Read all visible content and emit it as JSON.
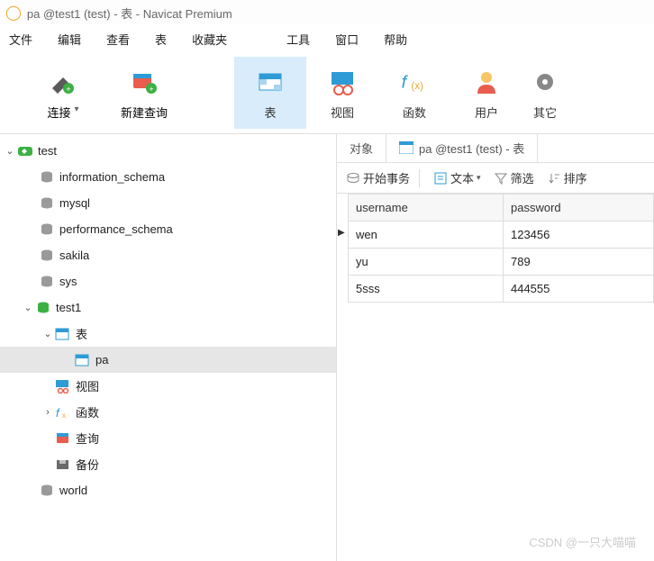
{
  "window": {
    "title": "pa @test1 (test) - 表 - Navicat Premium"
  },
  "menu": {
    "file": "文件",
    "edit": "编辑",
    "view": "查看",
    "table": "表",
    "favorites": "收藏夹",
    "tools": "工具",
    "window": "窗口",
    "help": "帮助"
  },
  "toolbar": {
    "connection": "连接",
    "new_query": "新建查询",
    "table": "表",
    "view": "视图",
    "function": "函数",
    "user": "用户",
    "other": "其它"
  },
  "tree": {
    "conn": "test",
    "dbs": {
      "information_schema": "information_schema",
      "mysql": "mysql",
      "performance_schema": "performance_schema",
      "sakila": "sakila",
      "sys": "sys",
      "test1": "test1",
      "world": "world"
    },
    "groups": {
      "tables": "表",
      "views": "视图",
      "functions": "函数",
      "queries": "查询",
      "backups": "备份"
    },
    "tables": {
      "pa": "pa"
    }
  },
  "tabs": {
    "objects": "对象",
    "current": "pa @test1 (test) - 表"
  },
  "gridtoolbar": {
    "begin_tx": "开始事务",
    "text": "文本",
    "filter": "筛选",
    "sort": "排序"
  },
  "chart_data": {
    "type": "table",
    "columns": [
      "username",
      "password"
    ],
    "rows": [
      {
        "username": "wen",
        "password": "123456"
      },
      {
        "username": "yu",
        "password": "789"
      },
      {
        "username": "5sss",
        "password": "444555"
      }
    ]
  },
  "watermark": "CSDN @一只大喵喵"
}
